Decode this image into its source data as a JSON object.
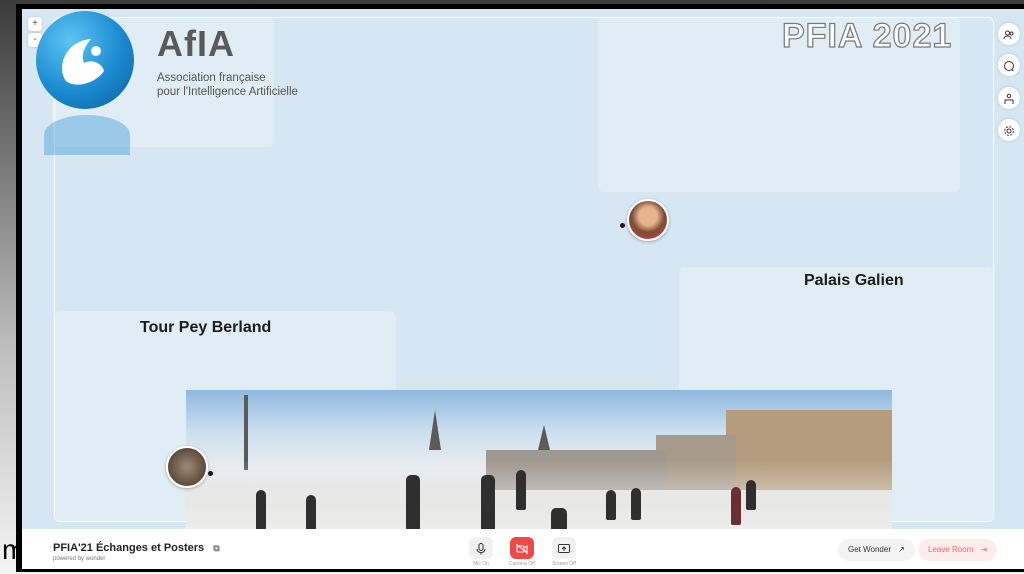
{
  "outer_text": "m",
  "zoom": {
    "in": "+",
    "out": "-"
  },
  "logo": {
    "title": "AfIA",
    "subtitle_line1": "Association française",
    "subtitle_line2": "pour l'Intelligence Artificielle"
  },
  "event_title": "PFIA 2021",
  "zones": {
    "palais": "Palais Galien",
    "tour": "Tour Pey Berland"
  },
  "right_toolbar": {
    "people_icon": "people-icon",
    "chat_icon": "chat-icon",
    "group_icon": "group-icon",
    "settings_icon": "gear-icon"
  },
  "bottom": {
    "room_name": "PFIA'21 Échanges et Posters",
    "copy_icon": "copy-icon",
    "powered_by": "powered by wonder",
    "mic_label": "Mic On",
    "camera_label": "Camera Off",
    "screen_label": "Screen Off",
    "get_wonder": "Get Wonder",
    "leave_room": "Leave Room"
  },
  "colors": {
    "accent_red": "#ef4a4a",
    "background": "#d6e6f2"
  }
}
